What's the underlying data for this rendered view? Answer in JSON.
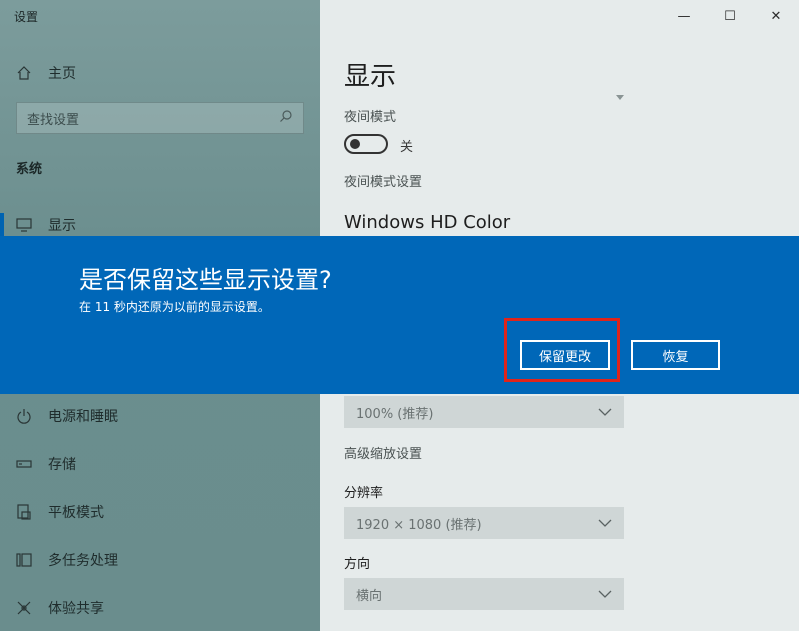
{
  "window": {
    "title": "设置",
    "controls": [
      "—",
      "☐",
      "✕"
    ]
  },
  "sidebar": {
    "home_label": "主页",
    "search_placeholder": "查找设置",
    "section": "系统",
    "items": [
      {
        "label": "显示",
        "icon": "monitor-icon",
        "active": true
      },
      {
        "label": "电源和睡眠",
        "icon": "power-icon"
      },
      {
        "label": "存储",
        "icon": "storage-icon"
      },
      {
        "label": "平板模式",
        "icon": "tablet-icon"
      },
      {
        "label": "多任务处理",
        "icon": "multitask-icon"
      },
      {
        "label": "体验共享",
        "icon": "share-icon"
      }
    ]
  },
  "content": {
    "title": "显示",
    "night_mode_label": "夜间模式",
    "night_mode_state": "关",
    "night_mode_settings": "夜间模式设置",
    "hd_color_heading": "Windows HD Color",
    "scale_value": "100% (推荐)",
    "advanced_scaling": "高级缩放设置",
    "resolution_label": "分辨率",
    "resolution_value": "1920 × 1080 (推荐)",
    "orientation_label": "方向",
    "orientation_value": "横向"
  },
  "dialog": {
    "title": "是否保留这些显示设置?",
    "message": "在 11 秒内还原为以前的显示设置。",
    "keep_button": "保留更改",
    "revert_button": "恢复",
    "accent_color": "#0067b8",
    "highlight_color": "#e0241b"
  }
}
